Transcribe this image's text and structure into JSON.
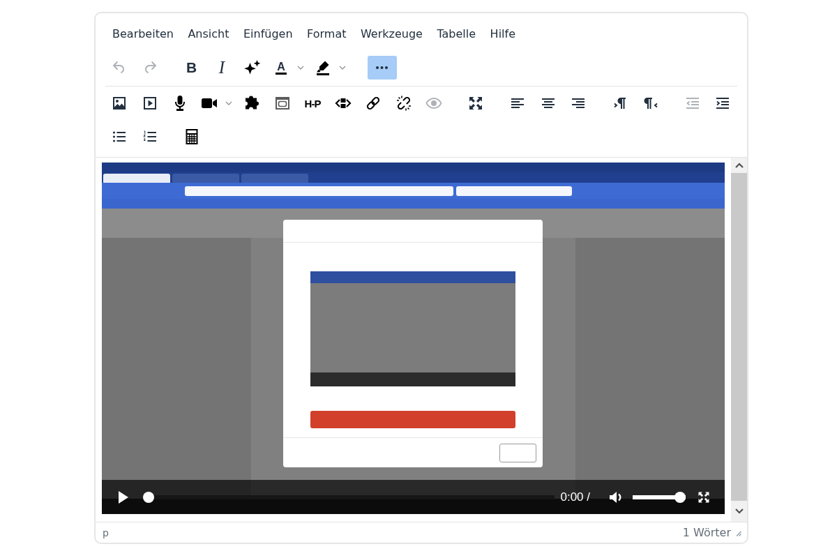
{
  "menu_bar": [
    "Bearbeiten",
    "Ansicht",
    "Einfügen",
    "Format",
    "Werkzeuge",
    "Tabelle",
    "Hilfe"
  ],
  "toolbar": [
    [
      {
        "kind": "icon",
        "disabled": true,
        "pressed": false
      },
      {
        "kind": "icon",
        "disabled": true,
        "pressed": false
      }
    ],
    [
      {
        "kind": "text",
        "label": "B",
        "disabled": false,
        "pressed": false
      },
      {
        "kind": "text",
        "label": "I",
        "disabled": false,
        "pressed": false
      },
      {
        "kind": "icon",
        "disabled": false,
        "pressed": false
      },
      {
        "kind": "split",
        "label": "A",
        "disabled": false,
        "pressed": false
      },
      {
        "kind": "split",
        "disabled": false,
        "pressed": false
      }
    ],
    [
      {
        "kind": "icon",
        "disabled": false,
        "pressed": true
      }
    ]
  ],
  "toolbar_overflow": [
    [
      {
        "kind": "icon",
        "disabled": false,
        "pressed": false
      },
      {
        "kind": "icon",
        "disabled": false,
        "pressed": false
      },
      {
        "kind": "icon",
        "disabled": false,
        "pressed": false
      },
      {
        "kind": "split",
        "disabled": false,
        "pressed": false
      },
      {
        "kind": "icon",
        "disabled": false,
        "pressed": false
      },
      {
        "kind": "icon",
        "disabled": false,
        "pressed": false
      },
      {
        "kind": "text",
        "label": "H-P",
        "disabled": false,
        "pressed": false
      },
      {
        "kind": "icon",
        "disabled": false,
        "pressed": false
      },
      {
        "kind": "icon",
        "disabled": false,
        "pressed": false
      },
      {
        "kind": "icon",
        "disabled": false,
        "pressed": false
      },
      {
        "kind": "icon",
        "disabled": true,
        "pressed": false
      }
    ],
    [
      {
        "kind": "icon",
        "disabled": false,
        "pressed": false
      }
    ],
    [
      {
        "kind": "icon",
        "disabled": false,
        "pressed": false
      },
      {
        "kind": "icon",
        "disabled": false,
        "pressed": false
      },
      {
        "kind": "icon",
        "disabled": false,
        "pressed": false
      }
    ],
    [
      {
        "kind": "icon",
        "disabled": false,
        "pressed": false
      },
      {
        "kind": "icon",
        "disabled": false,
        "pressed": false
      }
    ],
    [
      {
        "kind": "icon",
        "disabled": true,
        "pressed": false
      },
      {
        "kind": "icon",
        "disabled": false,
        "pressed": false
      }
    ],
    [
      {
        "kind": "icon",
        "disabled": false,
        "pressed": false
      },
      {
        "kind": "icon",
        "disabled": false,
        "pressed": false
      }
    ],
    [
      {
        "kind": "icon",
        "disabled": false,
        "pressed": false
      }
    ]
  ],
  "video": {
    "playing": false,
    "progress": {
      "level": 0
    },
    "time": "0:00 /",
    "muted": false,
    "volume": {
      "level": 1
    }
  },
  "status_bar": {
    "path": "p",
    "word_count": "1 Wörter"
  }
}
